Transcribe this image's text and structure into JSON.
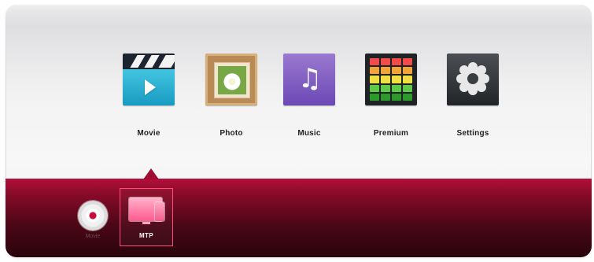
{
  "main_menu": {
    "items": [
      {
        "label": "Movie",
        "icon": "movie-icon"
      },
      {
        "label": "Photo",
        "icon": "photo-icon"
      },
      {
        "label": "Music",
        "icon": "music-icon"
      },
      {
        "label": "Premium",
        "icon": "premium-icon"
      },
      {
        "label": "Settings",
        "icon": "settings-icon"
      }
    ]
  },
  "devices": {
    "items": [
      {
        "label": "Movie",
        "icon": "disc-icon"
      },
      {
        "label": "MTP",
        "icon": "mtp-device-icon"
      }
    ]
  },
  "colors": {
    "device_bar": "#8a0b2a",
    "selection_border": "#ff4d7e",
    "movie_tile": "#189bc1",
    "music_tile": "#6c48b6",
    "settings_tile": "#3a3e42"
  },
  "music_symbol": "♫"
}
